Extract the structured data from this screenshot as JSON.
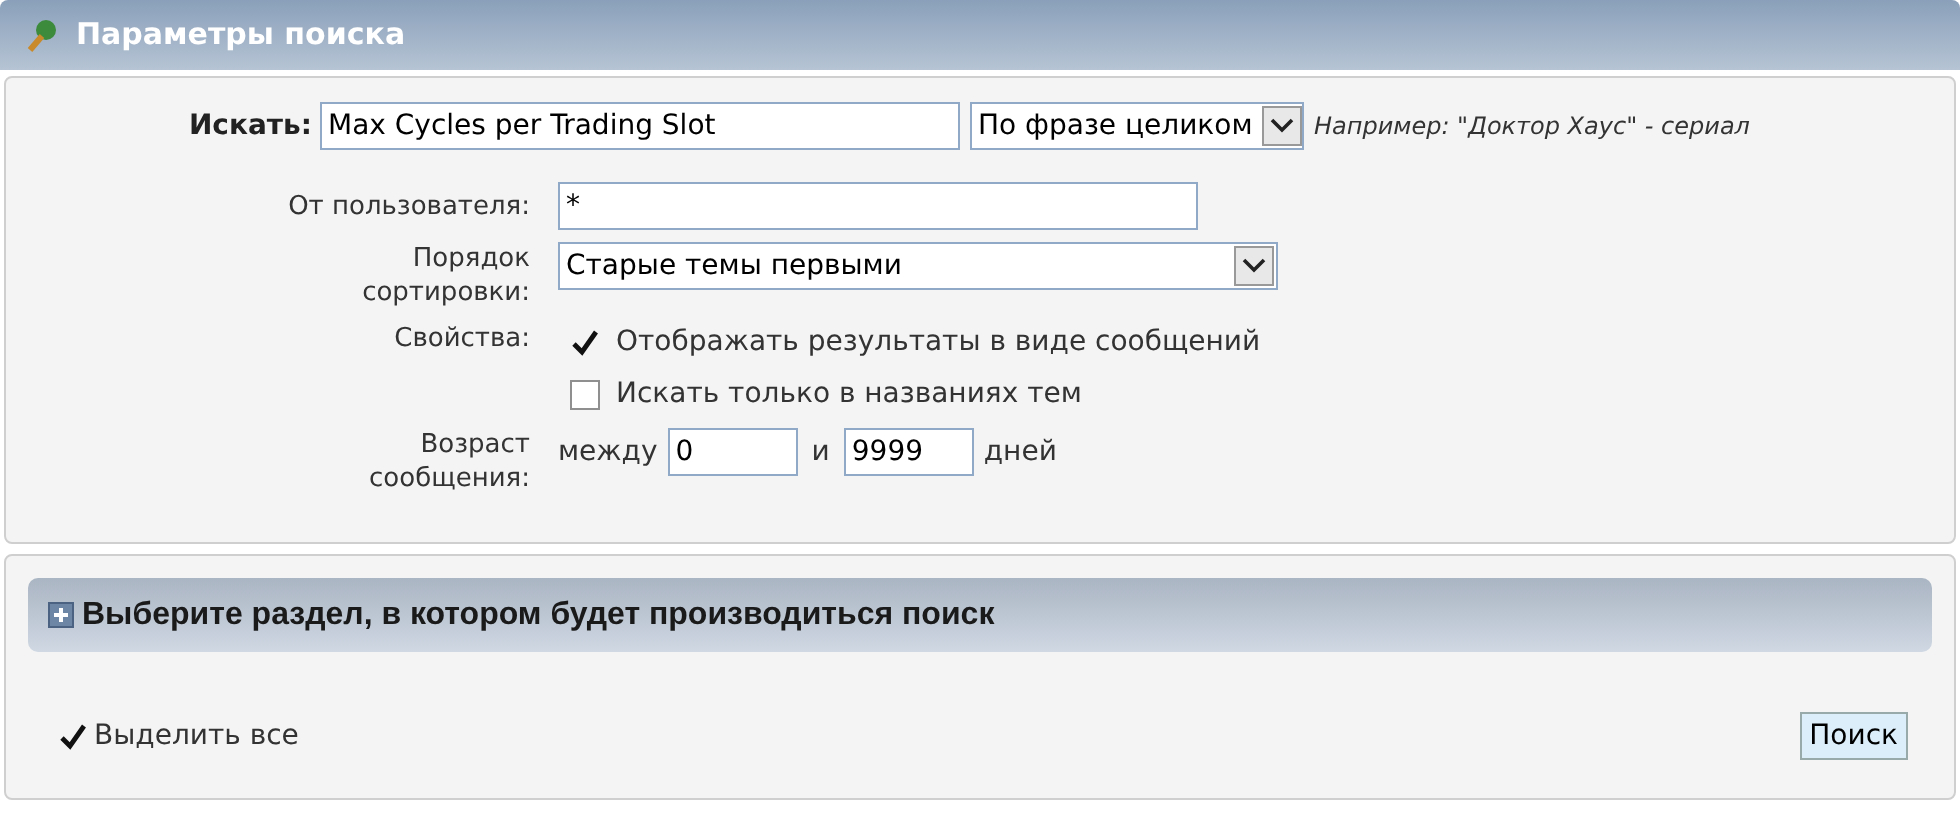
{
  "header": {
    "title": "Параметры поиска"
  },
  "search": {
    "label": "Искать:",
    "value": "Max Cycles per Trading Slot",
    "mode": "По фразе целиком",
    "hint": "Например: \"Доктор Хаус\" - сериал"
  },
  "user": {
    "label": "От пользователя:",
    "value": "*"
  },
  "sort": {
    "label_lines": [
      "Порядок",
      "сортировки:"
    ],
    "value": "Старые темы первыми"
  },
  "properties": {
    "label": "Свойства:",
    "options": [
      {
        "label": "Отображать результаты в виде сообщений",
        "checked": true
      },
      {
        "label": "Искать только в названиях тем",
        "checked": false
      }
    ]
  },
  "age": {
    "label_lines": [
      "Возраст",
      "сообщения:"
    ],
    "between": "между",
    "from": "0",
    "and": "и",
    "to": "9999",
    "unit": "дней"
  },
  "section": {
    "title": "Выберите раздел, в котором будет производиться поиск",
    "expanded": false
  },
  "select_all": {
    "label": "Выделить все",
    "checked": true
  },
  "submit": "Поиск"
}
